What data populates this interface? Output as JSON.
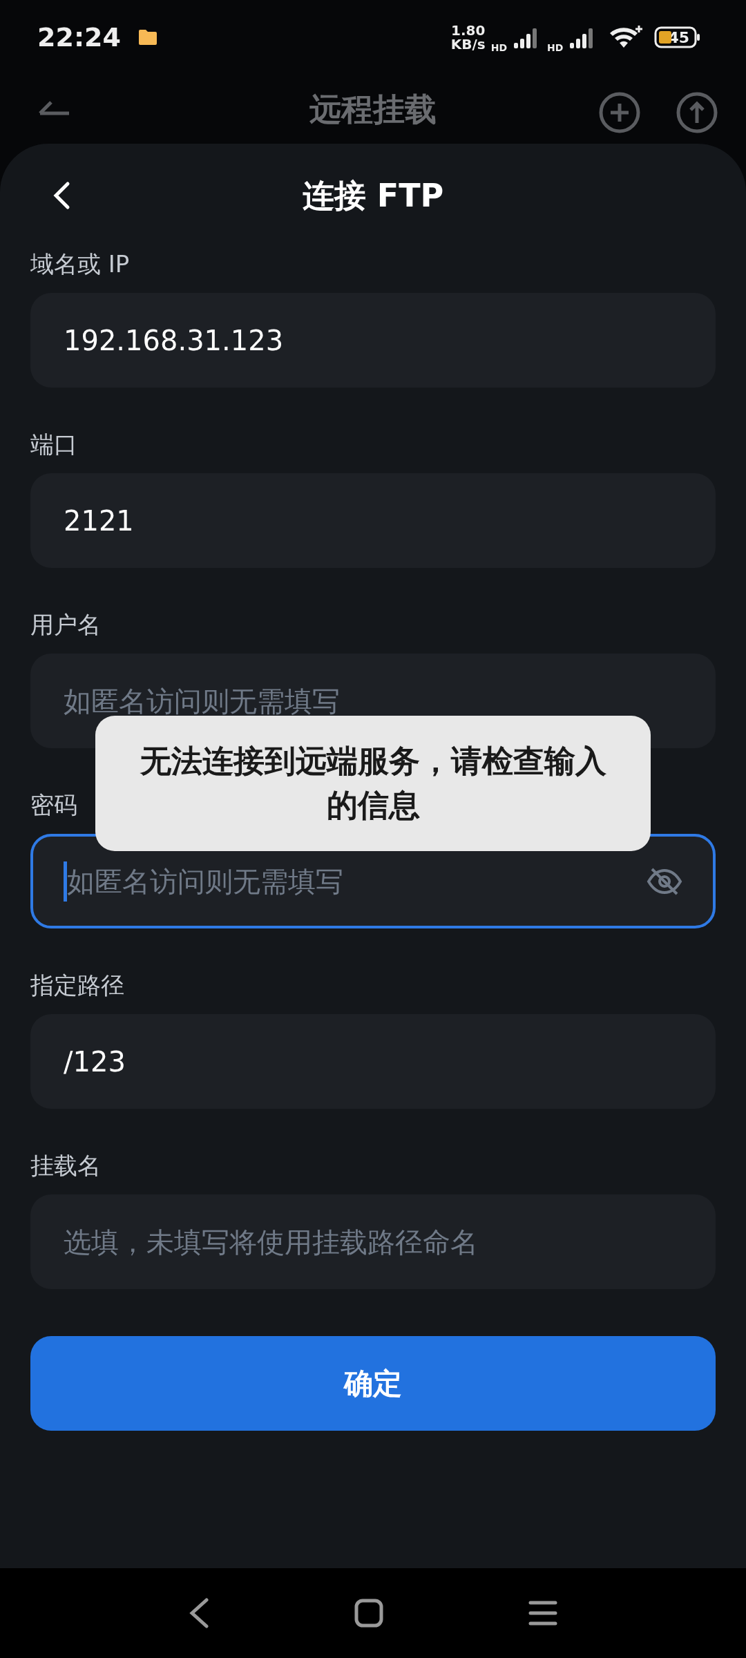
{
  "status_bar": {
    "time": "22:24",
    "net_speed_value": "1.80",
    "net_speed_unit": "KB/s",
    "sim_labels": [
      "HD",
      "HD"
    ],
    "battery": "45"
  },
  "background_header": {
    "title": "远程挂载"
  },
  "sheet": {
    "title": "连接 FTP"
  },
  "fields": [
    {
      "label": "域名或 IP",
      "value": "192.168.31.123",
      "focused": false,
      "kind": "text"
    },
    {
      "label": "端口",
      "value": "2121",
      "focused": false,
      "kind": "text"
    },
    {
      "label": "用户名",
      "placeholder": "如匿名访问则无需填写",
      "focused": false,
      "kind": "text"
    },
    {
      "label": "密码",
      "placeholder": "如匿名访问则无需填写",
      "focused": true,
      "kind": "password",
      "password_visible": false
    },
    {
      "label": "指定路径",
      "value": "/123",
      "focused": false,
      "kind": "text"
    },
    {
      "label": "挂载名",
      "placeholder": "选填，未填写将使用挂载路径命名",
      "focused": false,
      "kind": "text"
    }
  ],
  "toast": {
    "message": "无法连接到远端服务，请检查输入的信息"
  },
  "confirm_button": {
    "label": "确定"
  }
}
